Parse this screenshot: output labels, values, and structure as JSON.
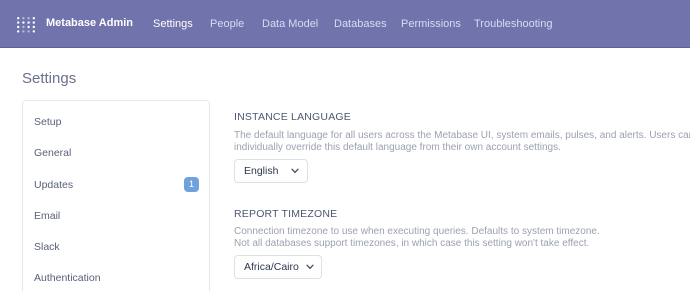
{
  "header": {
    "brand": "Metabase Admin",
    "logo_icon": "metabase-logo-icon",
    "nav": [
      {
        "label": "Settings",
        "active": true
      },
      {
        "label": "People",
        "active": false
      },
      {
        "label": "Data Model",
        "active": false
      },
      {
        "label": "Databases",
        "active": false
      },
      {
        "label": "Permissions",
        "active": false
      },
      {
        "label": "Troubleshooting",
        "active": false
      }
    ]
  },
  "page": {
    "title": "Settings"
  },
  "sidebar": {
    "items": [
      {
        "label": "Setup"
      },
      {
        "label": "General"
      },
      {
        "label": "Updates",
        "badge": "1"
      },
      {
        "label": "Email"
      },
      {
        "label": "Slack"
      },
      {
        "label": "Authentication"
      }
    ]
  },
  "settings": {
    "language": {
      "title": "INSTANCE LANGUAGE",
      "desc_line1": "The default language for all users across the Metabase UI, system emails, pulses, and alerts. Users can",
      "desc_line2": "individually override this default language from their own account settings.",
      "value": "English"
    },
    "timezone": {
      "title": "REPORT TIMEZONE",
      "desc_line1": "Connection timezone to use when executing queries. Defaults to system timezone.",
      "desc_line2": "Not all databases support timezones, in which case this setting won't take effect.",
      "value": "Africa/Cairo"
    }
  },
  "colors": {
    "header": "#7173ad",
    "badge": "#6fa1dc"
  }
}
